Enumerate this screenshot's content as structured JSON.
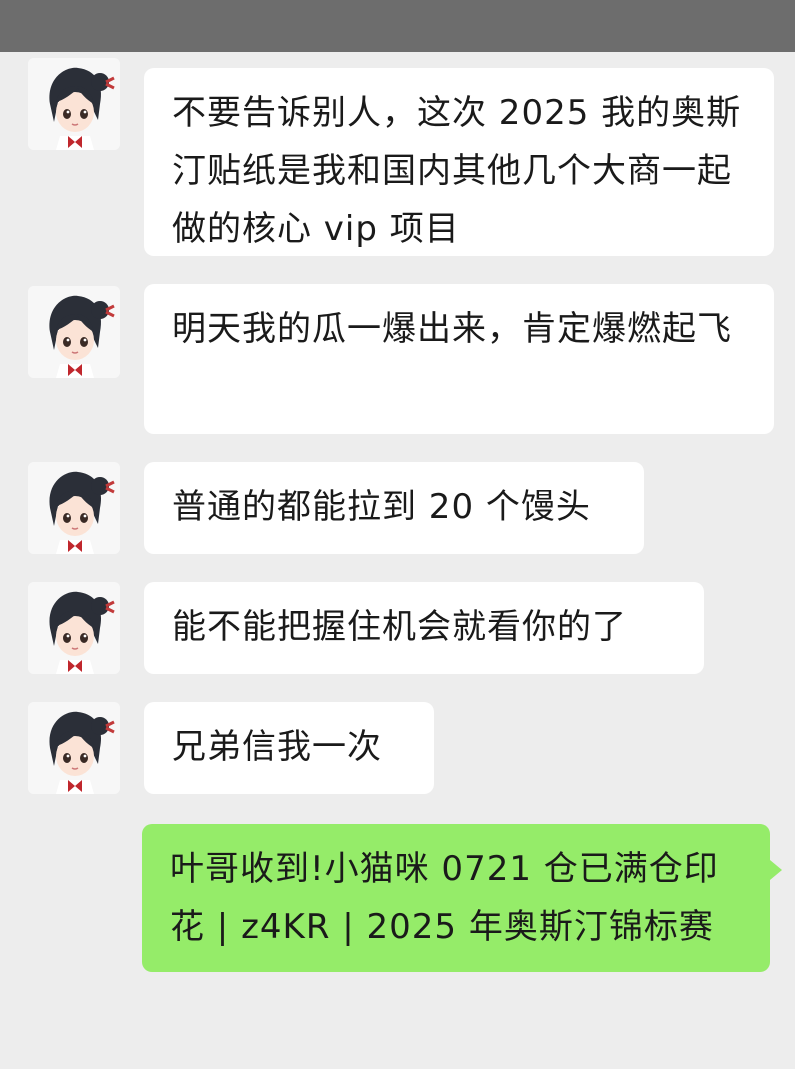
{
  "messages": [
    {
      "sender": "other",
      "text": "不要告诉别人，这次 2025 我的奥斯汀贴纸是我和国内其他几个大商一起做的核心 vip 项目"
    },
    {
      "sender": "other",
      "text": "明天我的瓜一爆出来，肯定爆燃起飞"
    },
    {
      "sender": "other",
      "text": "普通的都能拉到 20 个馒头"
    },
    {
      "sender": "other",
      "text": "能不能把握住机会就看你的了"
    },
    {
      "sender": "other",
      "text": "兄弟信我一次"
    },
    {
      "sender": "self",
      "text": "叶哥收到!小猫咪 0721 仓已满仓印花 | z4KR | 2025 年奥斯汀锦标赛"
    }
  ],
  "avatar_icon": "anime-girl-avatar-icon",
  "colors": {
    "top_bar": "#6d6d6d",
    "background": "#ededed",
    "incoming_bubble": "#ffffff",
    "outgoing_bubble": "#95ec69"
  }
}
